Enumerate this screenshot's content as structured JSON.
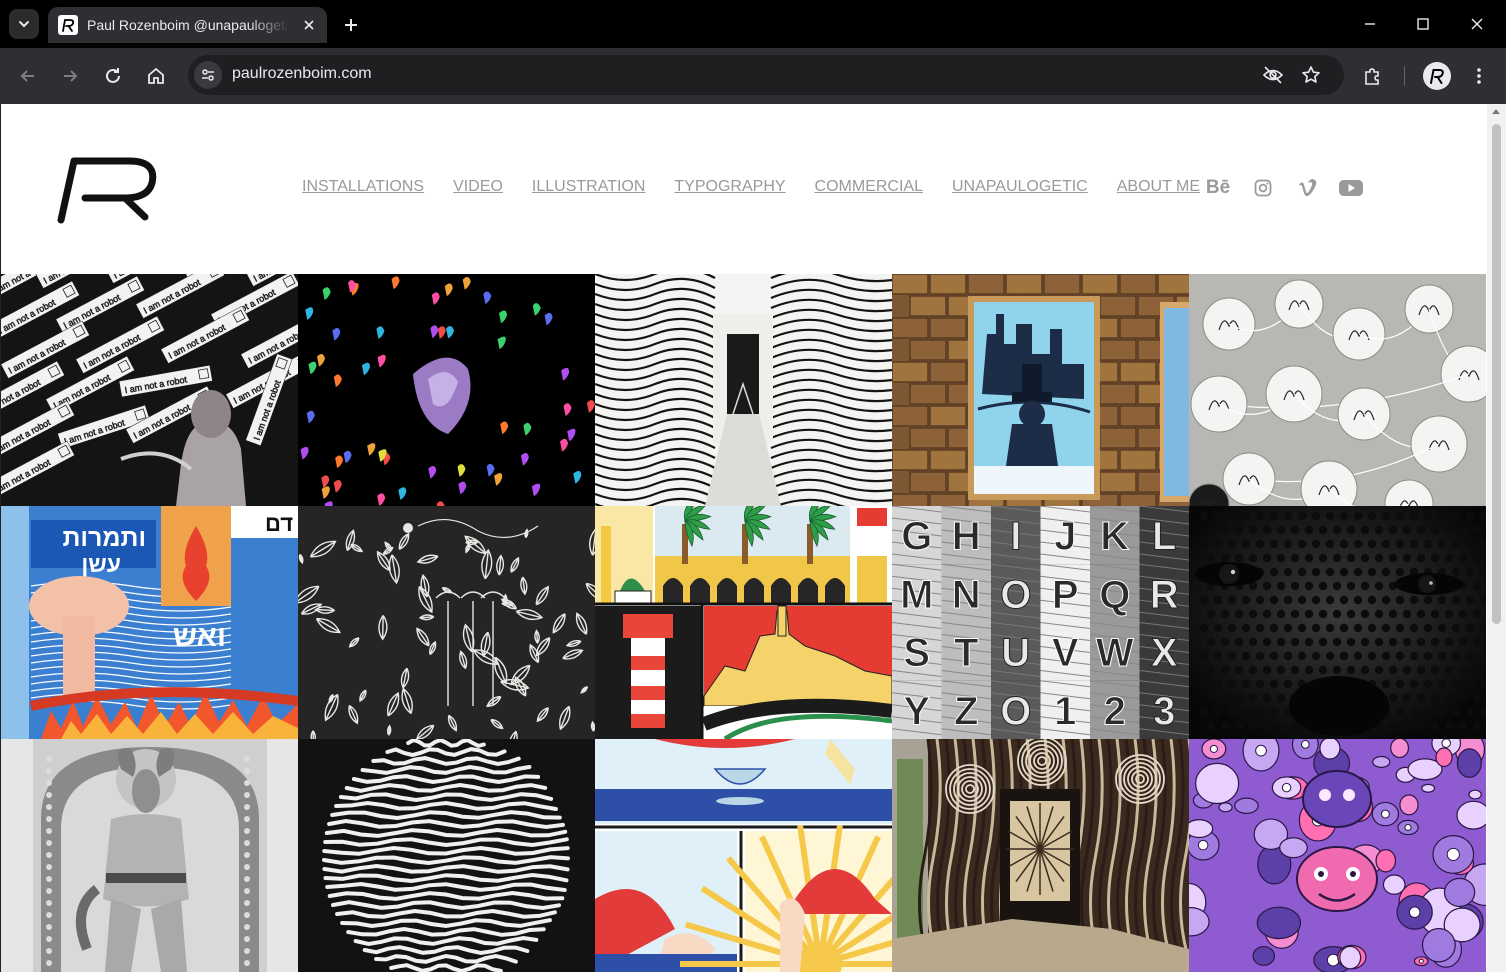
{
  "browser": {
    "tab_title": "Paul Rozenboim @unapaulogetic",
    "url": "paulrozenboim.com"
  },
  "icons": {
    "tab_list": "chevron-down-icon",
    "new_tab": "plus-icon",
    "back": "back-arrow-icon",
    "forward": "forward-arrow-icon",
    "reload": "reload-icon",
    "home": "home-icon",
    "site_info": "tune-icon",
    "tracking": "eye-off-icon",
    "bookmark": "star-icon",
    "extensions": "puzzle-icon",
    "menu": "kebab-menu-icon"
  },
  "site": {
    "logo": "R",
    "nav": [
      {
        "label": "INSTALLATIONS"
      },
      {
        "label": "VIDEO"
      },
      {
        "label": "ILLUSTRATION"
      },
      {
        "label": "TYPOGRAPHY"
      },
      {
        "label": "COMMERCIAL"
      },
      {
        "label": "UNAPAULOGETIC"
      },
      {
        "label": "ABOUT ME"
      }
    ],
    "social": {
      "behance": "Bē"
    }
  },
  "tiles": {
    "robot_label": "I am not a robot",
    "alphabet": [
      "G",
      "H",
      "I",
      "J",
      "K",
      "L",
      "M",
      "N",
      "O",
      "P",
      "Q",
      "R",
      "S",
      "T",
      "U",
      "V",
      "W",
      "X",
      "Y",
      "Z",
      "O",
      "1",
      "2",
      "3"
    ],
    "hebrew_title_1": "ותמרות",
    "hebrew_title_2": "עשן",
    "hebrew_fire": "ואש",
    "hebrew_corner": "דם"
  },
  "colors": {
    "nav_text": "#9a9a9a",
    "chrome_dark": "#000000",
    "toolbar": "#2f2f33"
  }
}
